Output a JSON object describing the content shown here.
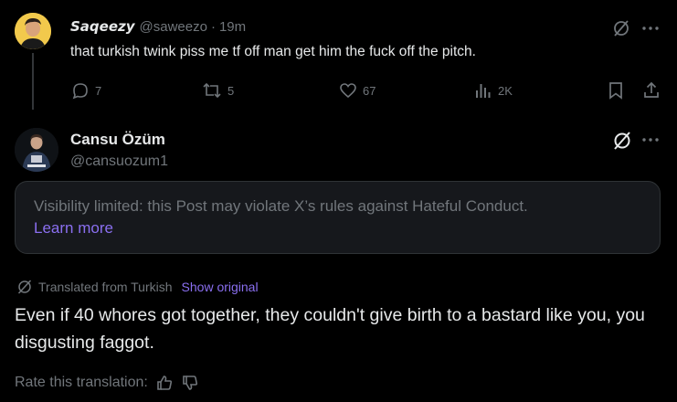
{
  "post1": {
    "display_name": "Saqeezy",
    "handle": "@saweezo",
    "separator": "·",
    "time": "19m",
    "text": "that turkish twink piss me tf off man get him the fuck off the pitch.",
    "stats": {
      "replies": "7",
      "reposts": "5",
      "likes": "67",
      "views": "2K"
    }
  },
  "post2": {
    "display_name": "Cansu Özüm",
    "handle": "@cansuozum1",
    "notice_text": "Visibility limited: this Post may violate X’s rules against Hateful Conduct.",
    "learn_more": "Learn more",
    "translated_label": "Translated from Turkish",
    "show_original": "Show original",
    "translation": "Even if 40 whores got together, they couldn't give birth to a bastard like you, you disgusting faggot.",
    "rate_label": "Rate this translation:"
  },
  "colors": {
    "background": "#000000",
    "text": "#e7e9ea",
    "muted": "#71767b",
    "link": "#8a6ff0",
    "notice_bg": "#16181c",
    "avatar1_bg": "#f2c94c"
  },
  "icons": {
    "grok": "grok-icon",
    "more": "more-icon",
    "reply": "reply-icon",
    "repost": "repost-icon",
    "like": "like-icon",
    "views": "views-icon",
    "bookmark": "bookmark-icon",
    "share": "share-icon",
    "thumbs_up": "thumbs-up-icon",
    "thumbs_down": "thumbs-down-icon"
  }
}
